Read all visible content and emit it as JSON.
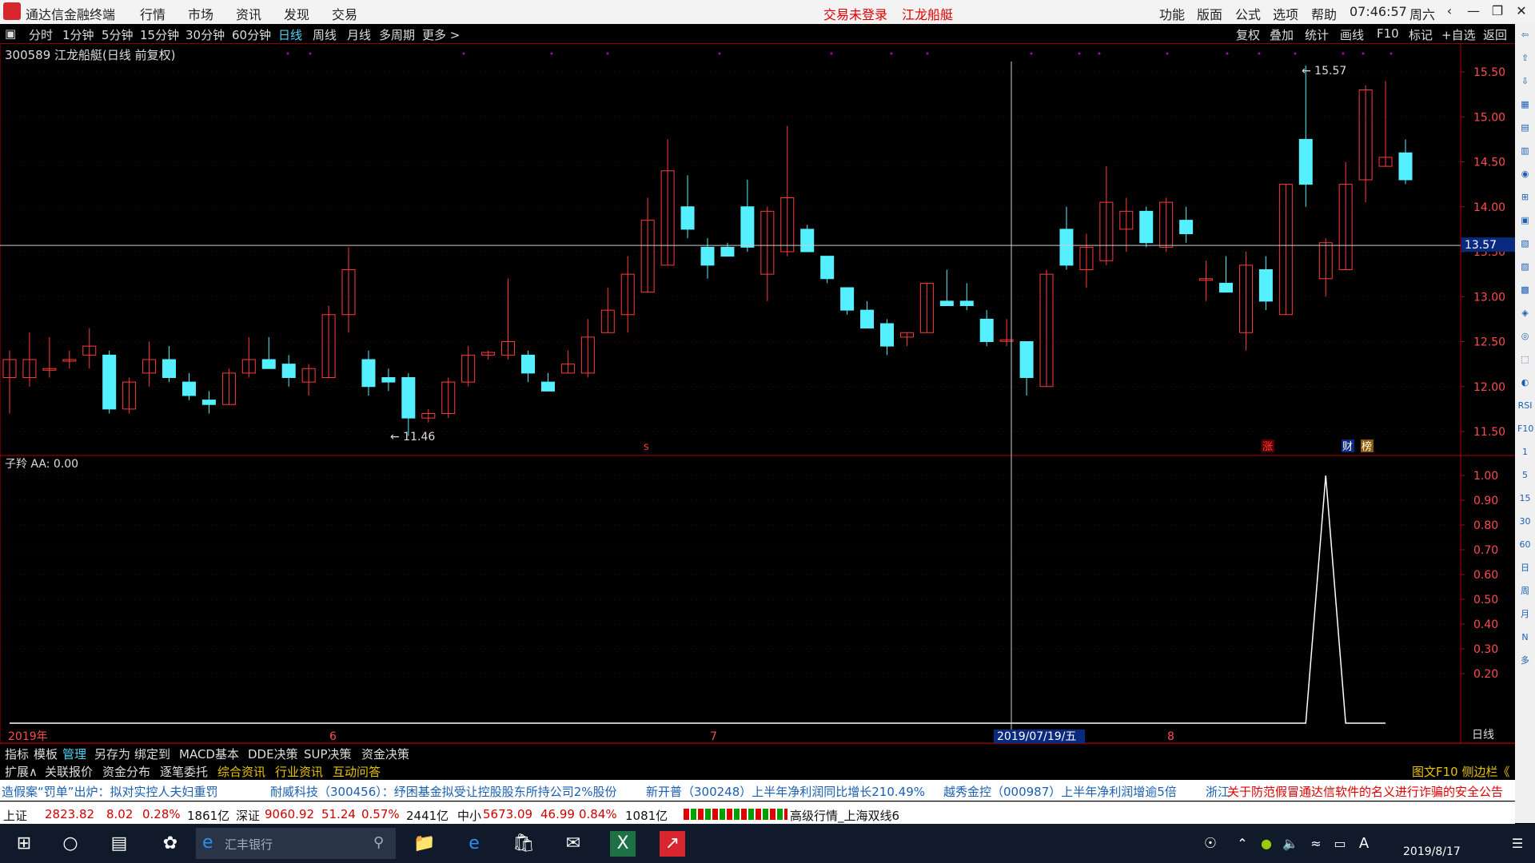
{
  "titlebar": {
    "app_title": "通达信金融终端",
    "menu": [
      "行情",
      "市场",
      "资讯",
      "发现",
      "交易"
    ],
    "login_status": "交易未登录",
    "stock_name": "江龙船艇",
    "right_menu": [
      "功能",
      "版面",
      "公式",
      "选项",
      "帮助"
    ],
    "time": "07:46:57",
    "weekday": "周六"
  },
  "toolbar": {
    "periods": [
      "分时",
      "1分钟",
      "5分钟",
      "15分钟",
      "30分钟",
      "60分钟",
      "日线",
      "周线",
      "月线",
      "多周期",
      "更多 >"
    ],
    "active_period": "日线",
    "right_buttons": [
      "复权",
      "叠加",
      "统计",
      "画线",
      "F10",
      "标记",
      "+自选",
      "返回"
    ]
  },
  "chart": {
    "stock_title": "300589 江龙船艇(日线 前复权)",
    "indicator_title": "子羚 AA: 0.00",
    "crosshair_price": "13.57",
    "crosshair_date": "2019/07/19/五",
    "high_label": "15.57",
    "low_label": "11.46",
    "markers": {
      "s": "s",
      "zhang": "涨",
      "cai": "财",
      "bang": "榜"
    },
    "period_label": "日线"
  },
  "chart_data": [
    {
      "type": "candlestick",
      "title": "300589 江龙船艇(日线 前复权)",
      "y_ticks": [
        11.5,
        12.0,
        12.5,
        13.0,
        13.5,
        14.0,
        14.5,
        15.0,
        15.5
      ],
      "ylim": [
        11.3,
        15.7
      ],
      "x_ticks": [
        "2019年",
        "6",
        "7",
        "8"
      ],
      "candles": [
        {
          "o": 12.1,
          "h": 12.4,
          "l": 11.7,
          "c": 12.3
        },
        {
          "o": 12.1,
          "h": 12.6,
          "l": 12.0,
          "c": 12.3
        },
        {
          "o": 12.2,
          "h": 12.55,
          "l": 12.1,
          "c": 12.2
        },
        {
          "o": 12.3,
          "h": 12.4,
          "l": 12.2,
          "c": 12.3
        },
        {
          "o": 12.35,
          "h": 12.65,
          "l": 12.2,
          "c": 12.45
        },
        {
          "o": 12.35,
          "h": 12.4,
          "l": 11.7,
          "c": 11.75
        },
        {
          "o": 11.75,
          "h": 12.1,
          "l": 11.7,
          "c": 12.05
        },
        {
          "o": 12.15,
          "h": 12.5,
          "l": 12.0,
          "c": 12.3
        },
        {
          "o": 12.3,
          "h": 12.45,
          "l": 12.05,
          "c": 12.1
        },
        {
          "o": 12.05,
          "h": 12.15,
          "l": 11.85,
          "c": 11.9
        },
        {
          "o": 11.85,
          "h": 11.95,
          "l": 11.7,
          "c": 11.8
        },
        {
          "o": 11.8,
          "h": 12.2,
          "l": 11.8,
          "c": 12.15
        },
        {
          "o": 12.15,
          "h": 12.55,
          "l": 12.1,
          "c": 12.3
        },
        {
          "o": 12.3,
          "h": 12.55,
          "l": 12.2,
          "c": 12.2
        },
        {
          "o": 12.25,
          "h": 12.35,
          "l": 12.0,
          "c": 12.1
        },
        {
          "o": 12.05,
          "h": 12.25,
          "l": 11.9,
          "c": 12.2
        },
        {
          "o": 12.1,
          "h": 12.9,
          "l": 12.1,
          "c": 12.8
        },
        {
          "o": 12.8,
          "h": 13.55,
          "l": 12.6,
          "c": 13.3
        },
        {
          "o": 12.3,
          "h": 12.4,
          "l": 11.9,
          "c": 12.0
        },
        {
          "o": 12.1,
          "h": 12.2,
          "l": 11.95,
          "c": 12.05
        },
        {
          "o": 12.1,
          "h": 12.15,
          "l": 11.45,
          "c": 11.65
        },
        {
          "o": 11.65,
          "h": 11.75,
          "l": 11.6,
          "c": 11.7
        },
        {
          "o": 11.7,
          "h": 12.1,
          "l": 11.65,
          "c": 12.05
        },
        {
          "o": 12.05,
          "h": 12.45,
          "l": 12.0,
          "c": 12.35
        },
        {
          "o": 12.35,
          "h": 12.4,
          "l": 12.3,
          "c": 12.38
        },
        {
          "o": 12.35,
          "h": 13.2,
          "l": 12.3,
          "c": 12.5
        },
        {
          "o": 12.35,
          "h": 12.4,
          "l": 12.05,
          "c": 12.15
        },
        {
          "o": 12.05,
          "h": 12.15,
          "l": 11.95,
          "c": 11.95
        },
        {
          "o": 12.15,
          "h": 12.4,
          "l": 12.15,
          "c": 12.25
        },
        {
          "o": 12.15,
          "h": 12.75,
          "l": 12.1,
          "c": 12.55
        },
        {
          "o": 12.6,
          "h": 13.1,
          "l": 12.6,
          "c": 12.85
        },
        {
          "o": 12.8,
          "h": 13.45,
          "l": 12.6,
          "c": 13.25
        },
        {
          "o": 13.05,
          "h": 14.1,
          "l": 13.05,
          "c": 13.85
        },
        {
          "o": 13.35,
          "h": 14.75,
          "l": 13.35,
          "c": 14.4
        },
        {
          "o": 14.0,
          "h": 14.35,
          "l": 13.65,
          "c": 13.75
        },
        {
          "o": 13.55,
          "h": 13.65,
          "l": 13.2,
          "c": 13.35
        },
        {
          "o": 13.55,
          "h": 13.6,
          "l": 13.45,
          "c": 13.45
        },
        {
          "o": 14.0,
          "h": 14.3,
          "l": 13.5,
          "c": 13.55
        },
        {
          "o": 13.25,
          "h": 14.0,
          "l": 12.95,
          "c": 13.95
        },
        {
          "o": 13.5,
          "h": 14.9,
          "l": 13.45,
          "c": 14.1
        },
        {
          "o": 13.75,
          "h": 13.8,
          "l": 13.5,
          "c": 13.5
        },
        {
          "o": 13.45,
          "h": 13.45,
          "l": 13.15,
          "c": 13.2
        },
        {
          "o": 13.1,
          "h": 13.1,
          "l": 12.8,
          "c": 12.85
        },
        {
          "o": 12.85,
          "h": 12.95,
          "l": 12.65,
          "c": 12.65
        },
        {
          "o": 12.7,
          "h": 12.75,
          "l": 12.35,
          "c": 12.45
        },
        {
          "o": 12.55,
          "h": 12.6,
          "l": 12.45,
          "c": 12.6
        },
        {
          "o": 12.6,
          "h": 13.15,
          "l": 12.6,
          "c": 13.15
        },
        {
          "o": 12.95,
          "h": 13.3,
          "l": 12.9,
          "c": 12.9
        },
        {
          "o": 12.95,
          "h": 13.15,
          "l": 12.85,
          "c": 12.9
        },
        {
          "o": 12.75,
          "h": 12.85,
          "l": 12.45,
          "c": 12.5
        },
        {
          "o": 12.52,
          "h": 12.75,
          "l": 12.45,
          "c": 12.52
        },
        {
          "o": 12.5,
          "h": 12.5,
          "l": 11.9,
          "c": 12.1
        },
        {
          "o": 12.0,
          "h": 13.3,
          "l": 12.0,
          "c": 13.25
        },
        {
          "o": 13.75,
          "h": 14.0,
          "l": 13.3,
          "c": 13.35
        },
        {
          "o": 13.3,
          "h": 13.7,
          "l": 13.1,
          "c": 13.55
        },
        {
          "o": 13.4,
          "h": 14.45,
          "l": 13.35,
          "c": 14.05
        },
        {
          "o": 13.75,
          "h": 14.1,
          "l": 13.5,
          "c": 13.95
        },
        {
          "o": 13.95,
          "h": 14.0,
          "l": 13.55,
          "c": 13.6
        },
        {
          "o": 13.55,
          "h": 14.1,
          "l": 13.5,
          "c": 14.05
        },
        {
          "o": 13.85,
          "h": 14.0,
          "l": 13.6,
          "c": 13.7
        },
        {
          "o": 13.2,
          "h": 13.4,
          "l": 12.95,
          "c": 13.2
        },
        {
          "o": 13.15,
          "h": 13.45,
          "l": 13.05,
          "c": 13.05
        },
        {
          "o": 12.6,
          "h": 13.5,
          "l": 12.4,
          "c": 13.35
        },
        {
          "o": 13.3,
          "h": 13.45,
          "l": 12.85,
          "c": 12.95
        },
        {
          "o": 12.8,
          "h": 14.25,
          "l": 12.8,
          "c": 14.25
        },
        {
          "o": 14.75,
          "h": 15.57,
          "l": 14.0,
          "c": 14.25
        },
        {
          "o": 13.2,
          "h": 13.65,
          "l": 13.0,
          "c": 13.6
        },
        {
          "o": 13.3,
          "h": 14.5,
          "l": 13.3,
          "c": 14.25
        },
        {
          "o": 14.3,
          "h": 15.35,
          "l": 14.05,
          "c": 15.3
        },
        {
          "o": 14.45,
          "h": 15.4,
          "l": 14.45,
          "c": 14.55
        },
        {
          "o": 14.6,
          "h": 14.75,
          "l": 14.25,
          "c": 14.3
        }
      ]
    },
    {
      "type": "line",
      "title": "子羚 AA: 0.00",
      "y_ticks": [
        0.2,
        0.3,
        0.4,
        0.5,
        0.6,
        0.7,
        0.8,
        0.9,
        1.0
      ],
      "ylim": [
        0,
        1.0
      ],
      "series": [
        {
          "values": [
            0,
            0,
            0,
            0,
            0,
            0,
            0,
            0,
            0,
            0,
            0,
            0,
            0,
            0,
            0,
            0,
            0,
            0,
            0,
            0,
            0,
            0,
            0,
            0,
            0,
            0,
            0,
            0,
            0,
            0,
            0,
            0,
            0,
            0,
            0,
            0,
            0,
            0,
            0,
            0,
            0,
            0,
            0,
            0,
            0,
            0,
            0,
            0,
            0,
            0,
            0,
            0,
            0,
            0,
            0,
            0,
            0,
            0,
            0,
            0,
            0,
            0,
            0,
            0,
            0,
            0,
            1,
            0,
            0,
            0
          ]
        }
      ]
    }
  ],
  "tabs1": [
    "指标",
    "模板",
    "管理",
    "另存为",
    "绑定到",
    "MACD基本",
    "DDE决策",
    "SUP决策",
    "资金决策"
  ],
  "tabs1_active": "管理",
  "tabs2": [
    "扩展∧",
    "关联报价",
    "资金分布",
    "逐笔委托",
    "综合资讯",
    "行业资讯",
    "互动问答"
  ],
  "tabs2_right": "图文F10 侧边栏《",
  "news": [
    "造假案“罚单”出炉：拟对实控人夫妇重罚",
    "耐威科技（300456）：纾困基金拟受让控股股东所持公司2%股份",
    "新开普（300248）上半年净利润同比增长210.49%",
    "越秀金控（000987）上半年净利润增逾5倍",
    "浙江",
    "关于防范假冒通达信软件的名义进行诈骗的安全公告"
  ],
  "status": {
    "sh_label": "上证",
    "sh_index": "2823.82",
    "sh_change": "8.02",
    "sh_pct": "0.28%",
    "sh_vol": "1861亿",
    "sz_label": "深证",
    "sz_index": "9060.92",
    "sz_change": "51.24",
    "sz_pct": "0.57%",
    "sz_vol": "2441亿",
    "zx_label": "中小",
    "zx_index": "5673.09",
    "zx_change": "46.99",
    "zx_pct": "0.84%",
    "zx_vol": "1081亿",
    "server": "高级行情_上海双线6"
  },
  "sidebar_labels": [
    "RSI",
    "F10",
    "1",
    "5",
    "15",
    "30",
    "60",
    "日",
    "周",
    "月",
    "N",
    "多"
  ],
  "taskbar": {
    "search_placeholder": "汇丰银行",
    "clock_date": "2019/8/17",
    "ime": "A"
  },
  "colors": {
    "up": "#ff3b3b",
    "down": "#54f0ff",
    "axis": "#b30000",
    "bg": "#000000"
  }
}
